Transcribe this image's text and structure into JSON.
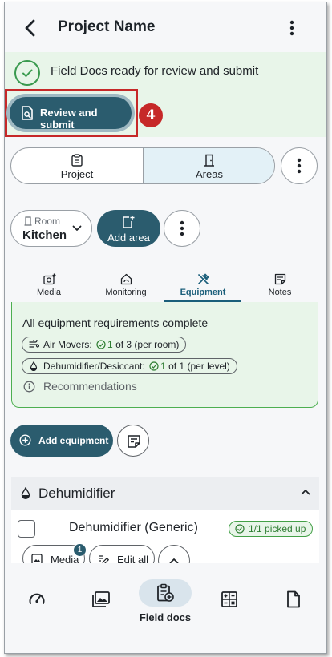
{
  "header": {
    "title": "Project Name"
  },
  "banner": {
    "text": "Field Docs ready for review and submit",
    "review_label": "Review and submit",
    "step_number": "4"
  },
  "segments": {
    "project": "Project",
    "areas": "Areas"
  },
  "room": {
    "label": "Room",
    "value": "Kitchen"
  },
  "add_area_label": "Add area",
  "tabs": [
    {
      "label": "Media"
    },
    {
      "label": "Monitoring"
    },
    {
      "label": "Equipment"
    },
    {
      "label": "Notes"
    }
  ],
  "requirements": {
    "title": "All equipment requirements complete",
    "air_movers": {
      "label": "Air Movers:",
      "count": "1",
      "rest": "of 3 (per room)"
    },
    "dehumidifier": {
      "label": "Dehumidifier/Desiccant:",
      "count": "1",
      "rest": "of 1 (per level)"
    },
    "recommendations": "Recommendations"
  },
  "add_equipment_label": "Add equipment",
  "equipment_section": {
    "title": "Dehumidifier",
    "item_name": "Dehumidifier (Generic)",
    "picked_status": "1/1 picked up",
    "media_label": "Media",
    "media_count": "1",
    "edit_label": "Edit all"
  },
  "bottom_nav": {
    "active_label": "Field docs"
  },
  "colors": {
    "primary": "#2b5c6e",
    "success": "#2e7d32",
    "banner_bg": "#e8f5e9",
    "highlight": "#c62828"
  }
}
